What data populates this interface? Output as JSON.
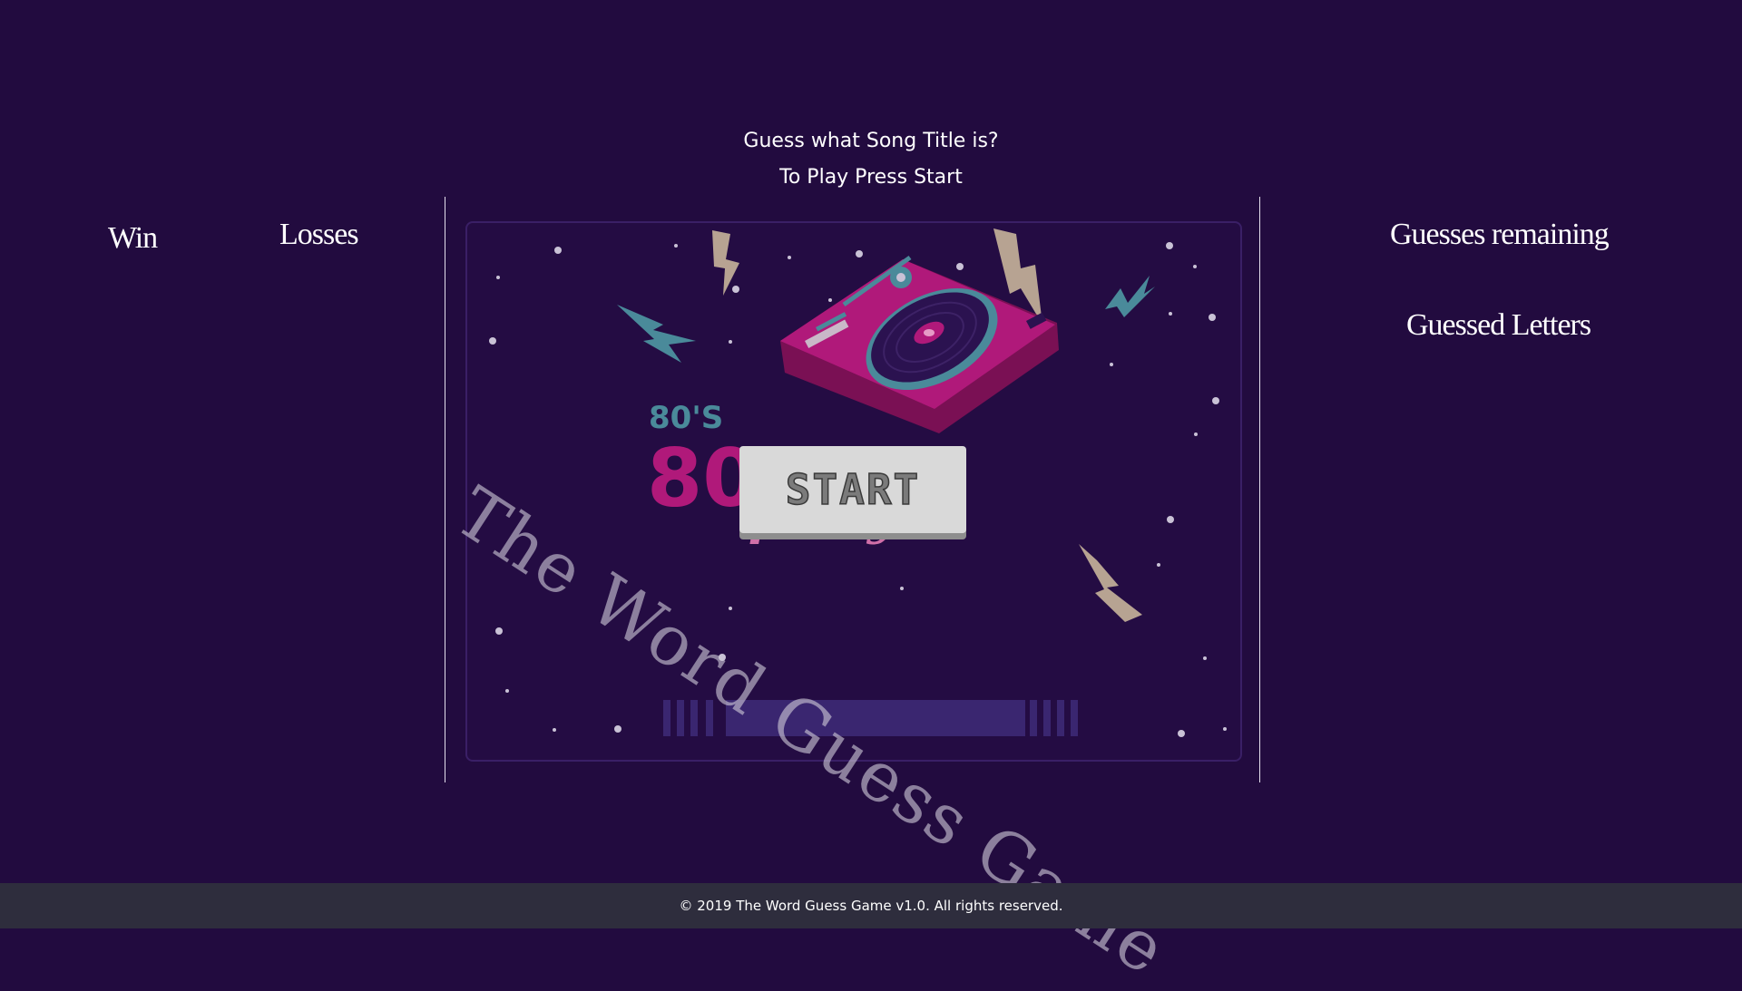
{
  "header": {
    "prompt_line1": "Guess what Song Title is?",
    "prompt_line2": "To Play Press Start"
  },
  "stats": {
    "win_label": "Win",
    "losses_label": "Losses",
    "guesses_remaining_label": "Guesses remaining",
    "guessed_letters_label": "Guessed Letters"
  },
  "artwork": {
    "subtitle": "80'S",
    "title_partial": "80",
    "script_partial": "party",
    "watermark": "The Word Guess Game"
  },
  "game": {
    "start_label": "START"
  },
  "footer": {
    "copyright": "© 2019 The Word Guess Game v1.0. All rights reserved."
  },
  "colors": {
    "background": "#220b3f",
    "panel": "#240c43",
    "turntable": "#b0197a",
    "teal": "#4a8a9a",
    "beige": "#b7a392",
    "footer": "#2e2d3d"
  }
}
